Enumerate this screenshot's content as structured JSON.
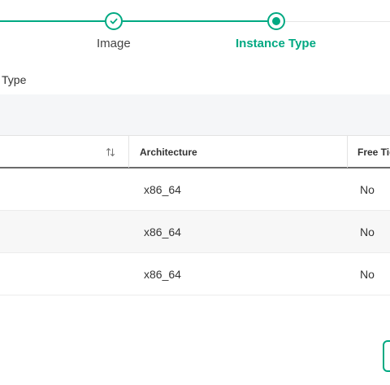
{
  "stepper": {
    "steps": [
      {
        "label": "Image",
        "state": "complete"
      },
      {
        "label": "Instance Type",
        "state": "current"
      }
    ],
    "accent": "#01a982"
  },
  "section": {
    "title": "Type"
  },
  "table": {
    "columns": [
      {
        "label": "",
        "sortable": true
      },
      {
        "label": "Architecture"
      },
      {
        "label": "Free Tier"
      }
    ],
    "rows": [
      {
        "architecture": "x86_64",
        "free_tier": "No"
      },
      {
        "architecture": "x86_64",
        "free_tier": "No"
      },
      {
        "architecture": "x86_64",
        "free_tier": "No"
      }
    ]
  }
}
